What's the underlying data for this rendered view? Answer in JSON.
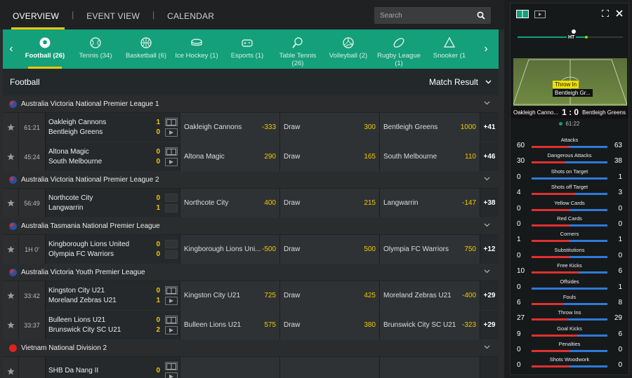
{
  "nav": {
    "tabs": [
      "OVERVIEW",
      "EVENT VIEW",
      "CALENDAR"
    ],
    "active": 0,
    "search_placeholder": "Search"
  },
  "sports": [
    {
      "label": "Football (26)",
      "icon": "soccer-ball-icon"
    },
    {
      "label": "Tennis (34)",
      "icon": "tennis-ball-icon"
    },
    {
      "label": "Basketball (6)",
      "icon": "basketball-icon"
    },
    {
      "label": "Ice Hockey (1)",
      "icon": "hockey-puck-icon"
    },
    {
      "label": "Esports (1)",
      "icon": "gamepad-icon"
    },
    {
      "label": "Table Tennis (26)",
      "icon": "table-tennis-icon"
    },
    {
      "label": "Volleyball (2)",
      "icon": "volleyball-icon"
    },
    {
      "label": "Rugby League (1)",
      "icon": "rugby-ball-icon"
    },
    {
      "label": "Snooker (1",
      "icon": "snooker-icon"
    }
  ],
  "header": {
    "sport": "Football",
    "market": "Match Result"
  },
  "leagues": [
    {
      "name": "Australia Victoria National Premier League 1",
      "flag": "au",
      "matches": [
        {
          "time": "61:21",
          "home": "Oakleigh Cannons",
          "away": "Bentleigh Greens",
          "hs": "1",
          "as": "0",
          "h": "Oakleigh Cannons",
          "ho": "-333",
          "d": "Draw",
          "do": "300",
          "a": "Bentleigh Greens",
          "ao": "1000",
          "more": "+41",
          "icons": true
        },
        {
          "time": "45:24",
          "home": "Altona Magic",
          "away": "South Melbourne",
          "hs": "0",
          "as": "0",
          "h": "Altona Magic",
          "ho": "290",
          "d": "Draw",
          "do": "165",
          "a": "South Melbourne",
          "ao": "110",
          "more": "+46",
          "icons": true
        }
      ]
    },
    {
      "name": "Australia Victoria National Premier League 2",
      "flag": "au",
      "matches": [
        {
          "time": "56:49",
          "home": "Northcote City",
          "away": "Langwarrin",
          "hs": "0",
          "as": "1",
          "h": "Northcote City",
          "ho": "400",
          "d": "Draw",
          "do": "215",
          "a": "Langwarrin",
          "ao": "-147",
          "more": "+38",
          "icons": false
        }
      ]
    },
    {
      "name": "Australia Tasmania National Premier League",
      "flag": "au",
      "matches": [
        {
          "time": "1H 0'",
          "home": "Kingborough Lions United",
          "away": "Olympia FC Warriors",
          "hs": "0",
          "as": "0",
          "h": "Kingborough Lions Uni...",
          "ho": "-500",
          "d": "Draw",
          "do": "500",
          "a": "Olympia FC Warriors",
          "ao": "750",
          "more": "+12",
          "icons": false
        }
      ]
    },
    {
      "name": "Australia Victoria Youth Premier League",
      "flag": "au",
      "matches": [
        {
          "time": "33:42",
          "home": "Kingston City U21",
          "away": "Moreland Zebras U21",
          "hs": "0",
          "as": "1",
          "h": "Kingston City U21",
          "ho": "725",
          "d": "Draw",
          "do": "425",
          "a": "Moreland Zebras U21",
          "ao": "-400",
          "more": "+29",
          "icons": true
        },
        {
          "time": "33:37",
          "home": "Bulleen Lions U21",
          "away": "Brunswick City SC U21",
          "hs": "0",
          "as": "2",
          "h": "Bulleen Lions U21",
          "ho": "575",
          "d": "Draw",
          "do": "380",
          "a": "Brunswick City SC U21",
          "ao": "-323",
          "more": "+29",
          "icons": true
        }
      ]
    },
    {
      "name": "Vietnam National Division 2",
      "flag": "vn",
      "matches": [
        {
          "time": "",
          "home": "SHB Da Nang II",
          "away": "",
          "hs": "0",
          "as": "",
          "h": "",
          "ho": "",
          "d": "",
          "do": "",
          "a": "",
          "ao": "",
          "more": "",
          "icons": true
        }
      ]
    }
  ],
  "tracker": {
    "ht_label": "HT",
    "event_type": "Throw In",
    "event_team": "Bentleigh Gr...",
    "home": "Oakleigh Canno...",
    "away": "Bentleigh Greens",
    "score": "1 : 0",
    "clock": "61:22"
  },
  "stats": [
    {
      "label": "Attacks",
      "home": "60",
      "away": "63",
      "home_share": 0.49
    },
    {
      "label": "Dangerous Attacks",
      "home": "30",
      "away": "38",
      "home_share": 0.44
    },
    {
      "label": "Shots on Target",
      "home": "0",
      "away": "1",
      "home_share": 0.0
    },
    {
      "label": "Shots off Target",
      "home": "4",
      "away": "3",
      "home_share": 0.57
    },
    {
      "label": "Yellow Cards",
      "home": "0",
      "away": "0",
      "home_share": 0.5
    },
    {
      "label": "Red Cards",
      "home": "0",
      "away": "0",
      "home_share": 0.5
    },
    {
      "label": "Corners",
      "home": "1",
      "away": "1",
      "home_share": 0.5
    },
    {
      "label": "Substitutions",
      "home": "0",
      "away": "0",
      "home_share": 0.5
    },
    {
      "label": "Free Kicks",
      "home": "10",
      "away": "6",
      "home_share": 0.62
    },
    {
      "label": "Offsides",
      "home": "0",
      "away": "1",
      "home_share": 0.0
    },
    {
      "label": "Fouls",
      "home": "6",
      "away": "8",
      "home_share": 0.43
    },
    {
      "label": "Throw Ins",
      "home": "27",
      "away": "29",
      "home_share": 0.48
    },
    {
      "label": "Goal Kicks",
      "home": "9",
      "away": "6",
      "home_share": 0.6
    },
    {
      "label": "Penalties",
      "home": "0",
      "away": "0",
      "home_share": 0.5
    },
    {
      "label": "Shots Woodwork",
      "home": "0",
      "away": "0",
      "home_share": 0.5
    }
  ]
}
